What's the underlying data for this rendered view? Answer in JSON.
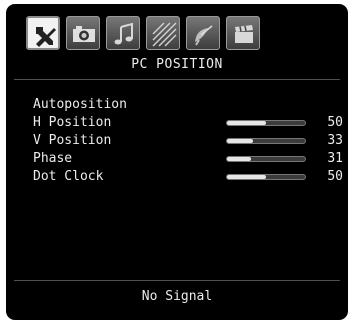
{
  "menu_tabs": [
    {
      "name": "tab-settings",
      "icon": "tools-icon",
      "active": true
    },
    {
      "name": "tab-picture",
      "icon": "camera-icon",
      "active": false
    },
    {
      "name": "tab-sound",
      "icon": "music-note-icon",
      "active": false
    },
    {
      "name": "tab-feature",
      "icon": "stripes-icon",
      "active": false
    },
    {
      "name": "tab-install",
      "icon": "satellite-dish-icon",
      "active": false
    },
    {
      "name": "tab-source",
      "icon": "clapperboard-icon",
      "active": false
    }
  ],
  "title": "PC POSITION",
  "items": [
    {
      "label": "Autoposition"
    },
    {
      "label": "H Position",
      "value": "50",
      "level": 50
    },
    {
      "label": "V Position",
      "value": "33",
      "level": 33
    },
    {
      "label": "Phase",
      "value": "31",
      "level": 31
    },
    {
      "label": "Dot Clock",
      "value": "50",
      "level": 50
    }
  ],
  "status": "No Signal"
}
